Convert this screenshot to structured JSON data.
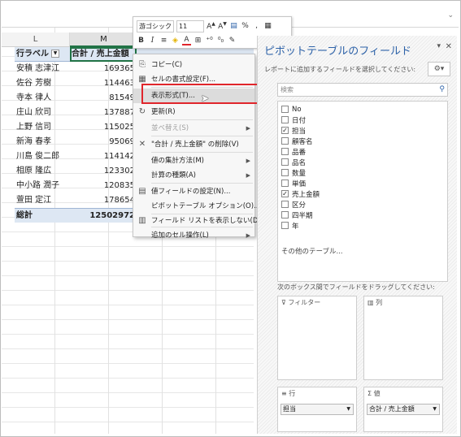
{
  "colors": {
    "pivot_header_bg": "#dde7f3",
    "accent_red": "#e0252b",
    "pane_title": "#2d62a8",
    "selection_green": "#217346"
  },
  "columns": {
    "l": "L",
    "m": "M"
  },
  "pivot": {
    "row_label_header": "行ラベル",
    "value_header": "合計 / 売上金額",
    "rows": [
      {
        "name": "安積 志津江",
        "value": "169365"
      },
      {
        "name": "佐谷 芳樹",
        "value": "114463"
      },
      {
        "name": "寺本 律人",
        "value": "81549"
      },
      {
        "name": "庄山 欣司",
        "value": "137887"
      },
      {
        "name": "上野 信司",
        "value": "115025"
      },
      {
        "name": "新海 春孝",
        "value": "95069"
      },
      {
        "name": "川島 俊二郎",
        "value": "114142"
      },
      {
        "name": "相原 隆広",
        "value": "123302"
      },
      {
        "name": "中小路 潤子",
        "value": "120835"
      },
      {
        "name": "萱田 定江",
        "value": "178654"
      }
    ],
    "total_label": "総計",
    "total_value": "12502972"
  },
  "mini_toolbar": {
    "font_name": "游ゴシック",
    "font_size": "11",
    "icons": [
      "font-grow-icon",
      "font-shrink-icon",
      "number-format-icon",
      "percent-icon",
      "comma-icon",
      "table-icon",
      "bold-icon",
      "italic-icon",
      "align-icon",
      "fill-color-icon",
      "font-color-icon",
      "border-icon",
      "decimal-increase-icon",
      "decimal-decrease-icon",
      "paint-icon"
    ],
    "bold": "B",
    "italic": "I",
    "percent": "%",
    "comma": ","
  },
  "context_menu": {
    "items": [
      {
        "label": "コピー(C)",
        "icon": "copy-icon"
      },
      {
        "label": "セルの書式設定(F)...",
        "icon": "format-cells-icon"
      },
      {
        "label": "表示形式(T)...",
        "icon": "",
        "highlighted": true
      },
      {
        "label": "更新(R)",
        "icon": "refresh-icon"
      },
      {
        "label": "並べ替え(S)",
        "icon": "",
        "disabled": true,
        "submenu": true
      },
      {
        "label": "\"合計 / 売上金額\" の削除(V)",
        "icon": "remove-icon"
      },
      {
        "label": "値の集計方法(M)",
        "icon": "",
        "submenu": true
      },
      {
        "label": "計算の種類(A)",
        "icon": "",
        "submenu": true
      },
      {
        "label": "値フィールドの設定(N)...",
        "icon": "field-settings-icon"
      },
      {
        "label": "ピボットテーブル オプション(O)...",
        "icon": ""
      },
      {
        "label": "フィールド リストを表示しない(D)",
        "icon": "field-list-icon"
      },
      {
        "label": "追加のセル操作(L)",
        "icon": "",
        "submenu": true
      }
    ]
  },
  "pane": {
    "title": "ピボットテーブルのフィールド",
    "hint": "レポートに追加するフィールドを選択してください:",
    "search_placeholder": "検索",
    "fields": [
      {
        "label": "No",
        "checked": false
      },
      {
        "label": "日付",
        "checked": false
      },
      {
        "label": "担当",
        "checked": true
      },
      {
        "label": "顧客名",
        "checked": false
      },
      {
        "label": "品番",
        "checked": false
      },
      {
        "label": "品名",
        "checked": false
      },
      {
        "label": "数量",
        "checked": false
      },
      {
        "label": "単価",
        "checked": false
      },
      {
        "label": "売上金額",
        "checked": true
      },
      {
        "label": "区分",
        "checked": false
      },
      {
        "label": "四半期",
        "checked": false
      },
      {
        "label": "年",
        "checked": false
      }
    ],
    "other_tables": "その他のテーブル...",
    "drag_hint": "次のボックス間でフィールドをドラッグしてください:",
    "areas": {
      "filter": "フィルター",
      "columns": "列",
      "rows": "行",
      "values": "値",
      "rows_chip": "担当",
      "values_chip": "合計 / 売上金額"
    }
  }
}
